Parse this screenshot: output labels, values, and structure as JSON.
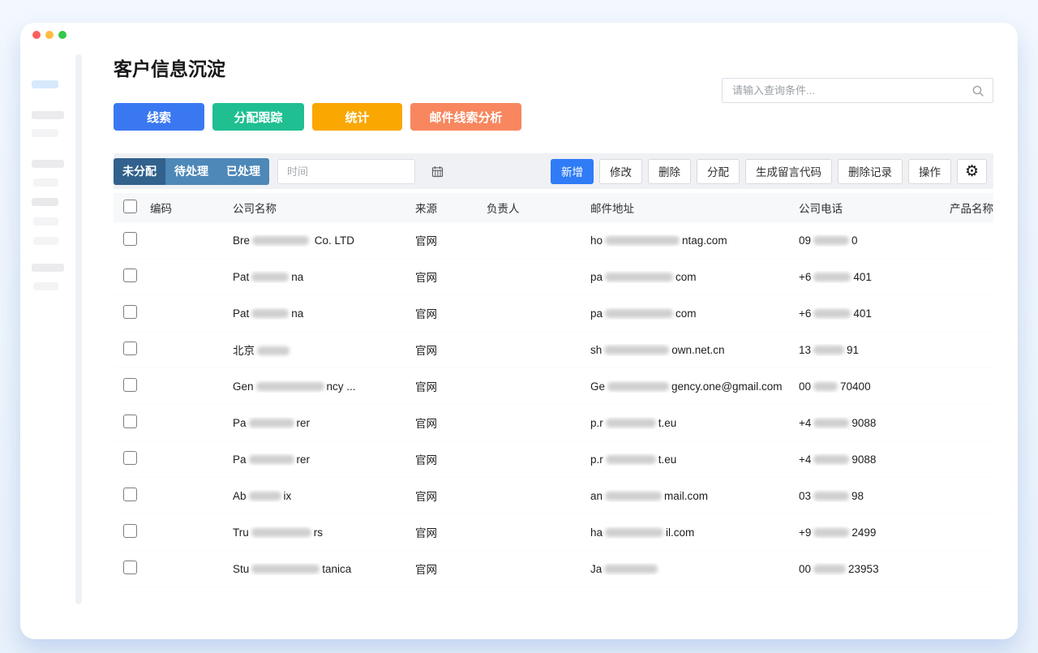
{
  "window": {
    "title": "客户信息沉淀",
    "controls": [
      "close",
      "minimize",
      "zoom"
    ]
  },
  "palette": {
    "dot_red": "#fc605c",
    "dot_yellow": "#fdbc40",
    "dot_green": "#34c749",
    "btn_blue": "#3a78f2",
    "btn_green": "#1fbf92",
    "btn_amber": "#faa702",
    "btn_salmon": "#f8875f",
    "tab_active": "#31618c",
    "tab_inactive": "#4e88b8",
    "primary_action": "#2f7cf6",
    "toolbar_bg": "#f0f1f4",
    "table_header_bg": "#f7f8fa"
  },
  "search": {
    "placeholder": "请输入查询条件...",
    "icon": "search-icon"
  },
  "nav_buttons": [
    {
      "label": "线索",
      "color": "#3a78f2"
    },
    {
      "label": "分配跟踪",
      "color": "#1fbf92"
    },
    {
      "label": "统计",
      "color": "#faa702"
    },
    {
      "label": "邮件线索分析",
      "color": "#f8875f"
    }
  ],
  "toolbar": {
    "tabs": [
      {
        "label": "未分配",
        "active": true
      },
      {
        "label": "待处理",
        "active": false
      },
      {
        "label": "已处理",
        "active": false
      }
    ],
    "date_placeholder": "时间",
    "date_icon": "calendar-icon",
    "actions": [
      {
        "label": "新增",
        "primary": true
      },
      {
        "label": "修改",
        "primary": false
      },
      {
        "label": "删除",
        "primary": false
      },
      {
        "label": "分配",
        "primary": false
      },
      {
        "label": "生成留言代码",
        "primary": false
      },
      {
        "label": "删除记录",
        "primary": false
      },
      {
        "label": "操作",
        "primary": false
      }
    ],
    "settings_icon": "gear-icon"
  },
  "table": {
    "headers": [
      "编码",
      "公司名称",
      "来源",
      "负责人",
      "邮件地址",
      "公司电话",
      "产品名称"
    ],
    "rows": [
      {
        "code": "",
        "company": {
          "pre": "Bre",
          "bw": 70,
          "suf": " Co. LTD"
        },
        "source": "官网",
        "owner": "",
        "email": {
          "pre": "ho",
          "bw": 92,
          "suf": "ntag.com"
        },
        "phone": {
          "pre": "09",
          "bw": 44,
          "suf": "0"
        },
        "product": ""
      },
      {
        "code": "",
        "company": {
          "pre": "Pat",
          "bw": 46,
          "suf": "na"
        },
        "source": "官网",
        "owner": "",
        "email": {
          "pre": "pa",
          "bw": 84,
          "suf": "com"
        },
        "phone": {
          "pre": "+6",
          "bw": 46,
          "suf": "401"
        },
        "product": ""
      },
      {
        "code": "",
        "company": {
          "pre": "Pat",
          "bw": 46,
          "suf": "na"
        },
        "source": "官网",
        "owner": "",
        "email": {
          "pre": "pa",
          "bw": 84,
          "suf": "com"
        },
        "phone": {
          "pre": "+6",
          "bw": 46,
          "suf": "401"
        },
        "product": ""
      },
      {
        "code": "",
        "company": {
          "pre": "北京",
          "bw": 40,
          "suf": ""
        },
        "source": "官网",
        "owner": "",
        "email": {
          "pre": "sh",
          "bw": 80,
          "suf": "own.net.cn"
        },
        "phone": {
          "pre": "13",
          "bw": 38,
          "suf": "91"
        },
        "product": ""
      },
      {
        "code": "",
        "company": {
          "pre": "Gen",
          "bw": 84,
          "suf": "ncy ..."
        },
        "source": "官网",
        "owner": "",
        "email": {
          "pre": "Ge",
          "bw": 76,
          "suf": "gency.one@gmail.com"
        },
        "phone": {
          "pre": "00",
          "bw": 30,
          "suf": "70400"
        },
        "product": ""
      },
      {
        "code": "",
        "company": {
          "pre": "Pa",
          "bw": 56,
          "suf": "rer"
        },
        "source": "官网",
        "owner": "",
        "email": {
          "pre": "p.r",
          "bw": 62,
          "suf": "t.eu"
        },
        "phone": {
          "pre": "+4",
          "bw": 44,
          "suf": "9088"
        },
        "product": ""
      },
      {
        "code": "",
        "company": {
          "pre": "Pa",
          "bw": 56,
          "suf": "rer"
        },
        "source": "官网",
        "owner": "",
        "email": {
          "pre": "p.r",
          "bw": 62,
          "suf": "t.eu"
        },
        "phone": {
          "pre": "+4",
          "bw": 44,
          "suf": "9088"
        },
        "product": ""
      },
      {
        "code": "",
        "company": {
          "pre": "Ab",
          "bw": 40,
          "suf": "ix"
        },
        "source": "官网",
        "owner": "",
        "email": {
          "pre": "an",
          "bw": 70,
          "suf": "mail.com"
        },
        "phone": {
          "pre": "03",
          "bw": 44,
          "suf": "98"
        },
        "product": ""
      },
      {
        "code": "",
        "company": {
          "pre": "Tru",
          "bw": 74,
          "suf": "rs"
        },
        "source": "官网",
        "owner": "",
        "email": {
          "pre": "ha",
          "bw": 72,
          "suf": "il.com"
        },
        "phone": {
          "pre": "+9",
          "bw": 44,
          "suf": "2499"
        },
        "product": ""
      },
      {
        "code": "",
        "company": {
          "pre": "Stu",
          "bw": 84,
          "suf": "tanica"
        },
        "source": "官网",
        "owner": "",
        "email": {
          "pre": "Ja",
          "bw": 66,
          "suf": ""
        },
        "phone": {
          "pre": "00",
          "bw": 40,
          "suf": "23953"
        },
        "product": ""
      }
    ]
  }
}
